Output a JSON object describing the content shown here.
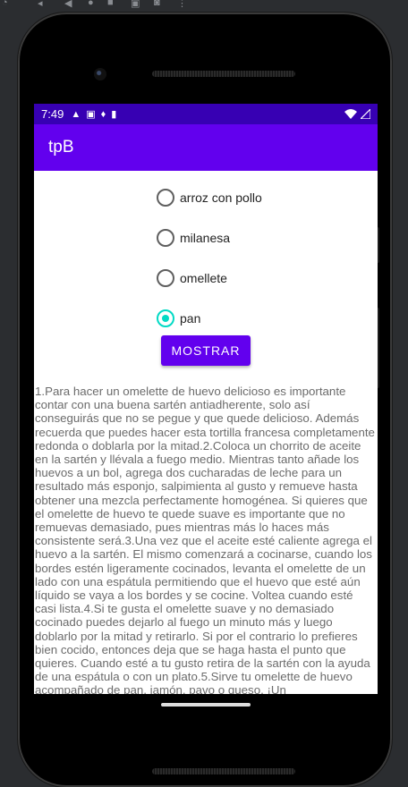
{
  "status_bar": {
    "time": "7:49",
    "left_icons": [
      "warning-icon",
      "a-icon",
      "drop-icon",
      "sd-card-icon"
    ],
    "right_icons": [
      "wifi-icon",
      "signal-icon"
    ]
  },
  "app": {
    "title": "tpB"
  },
  "options": [
    {
      "label": "arroz con pollo",
      "checked": false
    },
    {
      "label": "milanesa",
      "checked": false
    },
    {
      "label": "omellete",
      "checked": false
    },
    {
      "label": "pan",
      "checked": true
    }
  ],
  "show_button_label": "MOSTRAR",
  "recipe_text": "1.Para hacer un omelette de huevo delicioso es importante contar con una buena sartén antiadherente, solo así conseguirás que no se pegue y que quede delicioso. Además recuerda que puedes hacer esta tortilla francesa completamente redonda o doblarla por la mitad.2.Coloca un chorrito de aceite en la sartén y llévala a fuego medio. Mientras tanto añade los huevos a un bol, agrega dos cucharadas de leche para un resultado más esponjo, salpimienta al gusto y remueve hasta obtener una mezcla perfectamente homogénea. Si quieres que el omelette de huevo te quede suave es importante que no remuevas demasiado, pues mientras más lo haces más consistente será.3.Una vez que el aceite esté caliente agrega el huevo a la sartén. El mismo comenzará a cocinarse, cuando los bordes estén ligeramente cocinados, levanta el omelette de un lado con una espátula permitiendo que el huevo que esté aún líquido se vaya a los bordes y se cocine. Voltea cuando esté casi lista.4.Si te gusta el omelette suave y no demasiado cocinado puedes dejarlo al fuego un minuto más y luego doblarlo por la mitad y retirarlo. Si por el contrario lo prefieres bien cocido, entonces deja que se haga hasta el punto que quieres. Cuando esté a tu gusto retira de la sartén con la ayuda de una espátula o con un plato.5.Sirve tu omelette de huevo acompañado de pan, jamón, pavo o queso. ¡Un"
}
